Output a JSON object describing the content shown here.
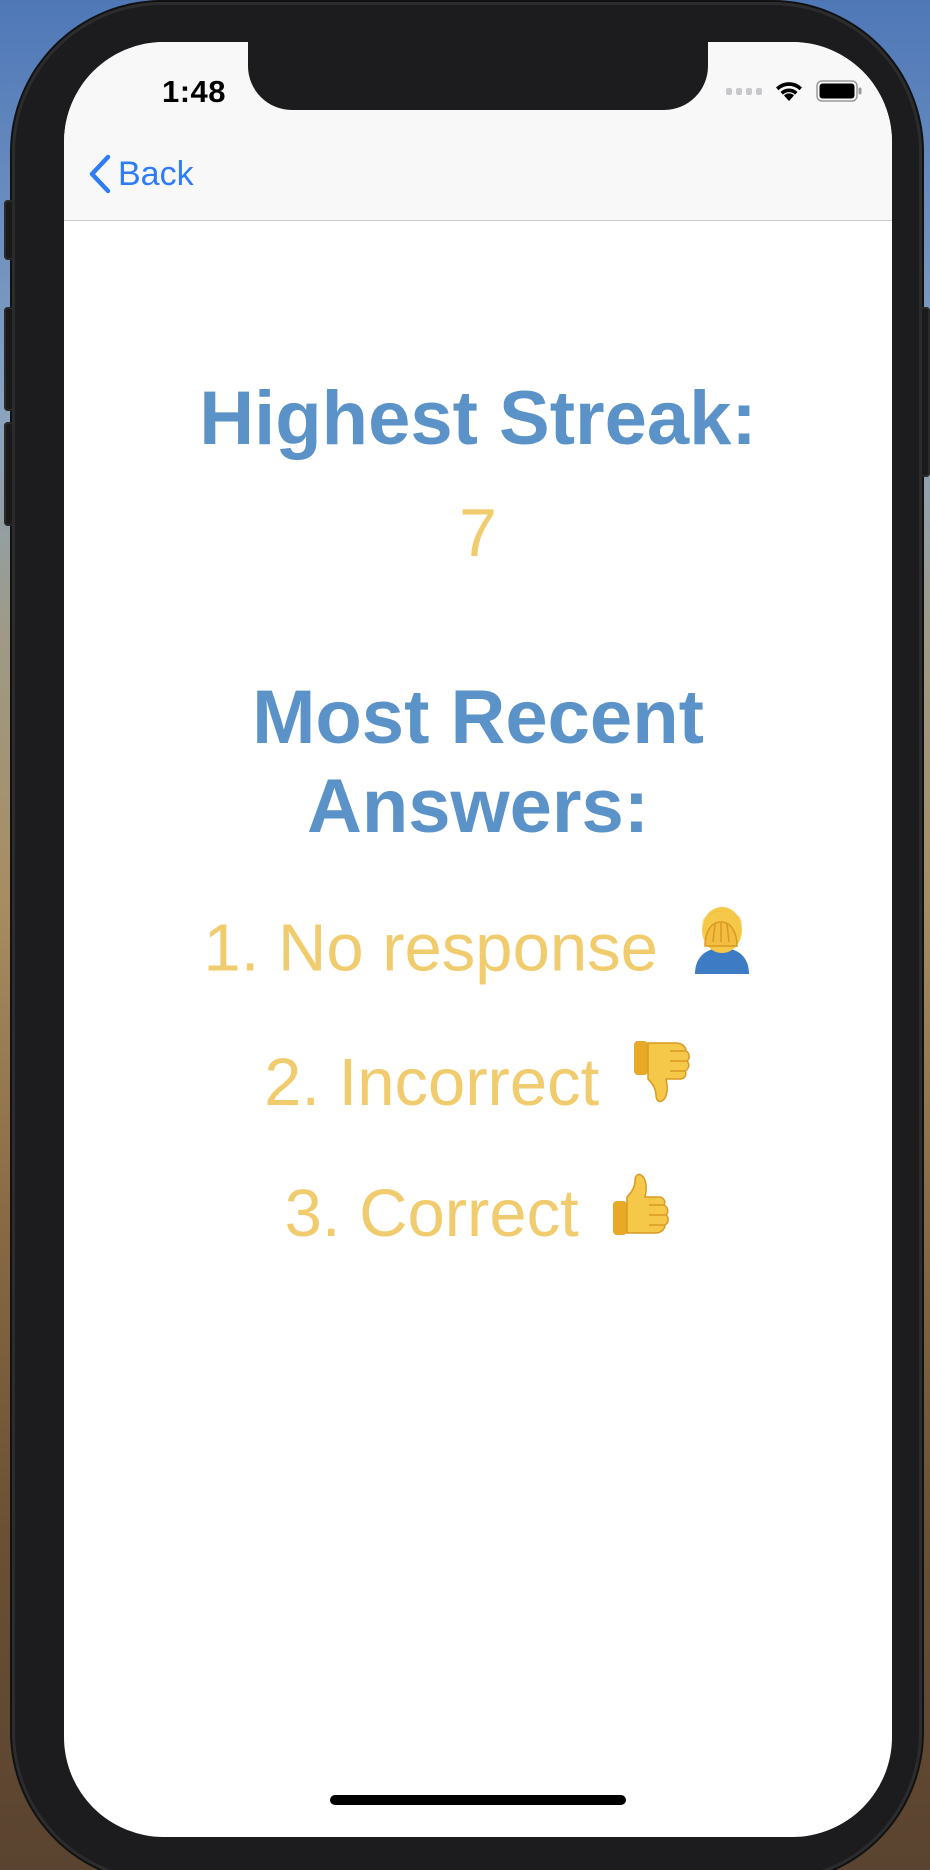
{
  "status_bar": {
    "time": "1:48"
  },
  "nav": {
    "back_label": "Back",
    "accent_color": "#2f7cf6"
  },
  "stats": {
    "streak_heading": "Highest Streak:",
    "streak_value": "7",
    "recent_heading_line1": "Most Recent",
    "recent_heading_line2": "Answers:",
    "answers": [
      {
        "text": "1. No response",
        "icon": "face-palm-icon"
      },
      {
        "text": "2. Incorrect",
        "icon": "thumbs-down-icon"
      },
      {
        "text": "3. Correct",
        "icon": "thumbs-up-icon"
      }
    ]
  },
  "colors": {
    "heading": "#5b92c8",
    "value": "#f0cc6e"
  }
}
